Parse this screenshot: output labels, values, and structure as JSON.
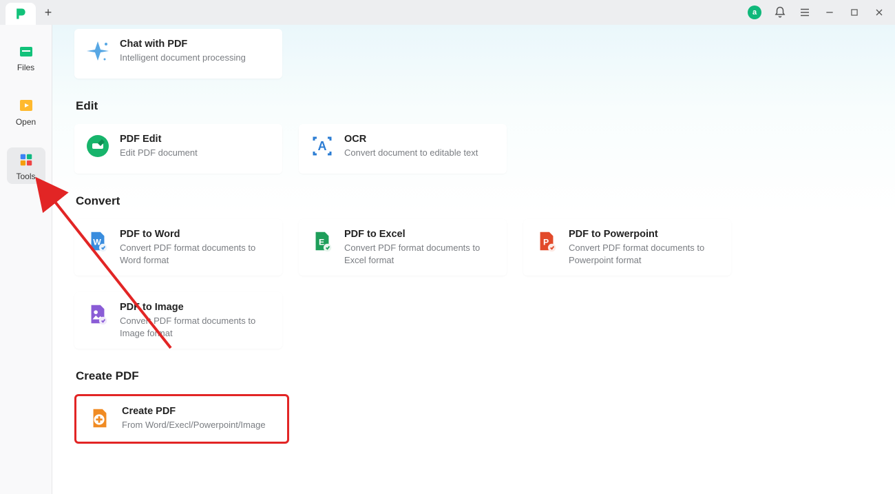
{
  "titlebar": {
    "user_letter": "a"
  },
  "sidebar": {
    "items": [
      {
        "label": "Files"
      },
      {
        "label": "Open"
      },
      {
        "label": "Tools"
      }
    ]
  },
  "sections": {
    "chat": {
      "card": {
        "title": "Chat with PDF",
        "desc": "Intelligent document processing"
      }
    },
    "edit": {
      "title": "Edit",
      "cards": [
        {
          "title": "PDF Edit",
          "desc": "Edit PDF document"
        },
        {
          "title": "OCR",
          "desc": "Convert document to editable text"
        }
      ]
    },
    "convert": {
      "title": "Convert",
      "cards": [
        {
          "title": "PDF to Word",
          "desc": "Convert PDF format documents to Word format"
        },
        {
          "title": "PDF to Excel",
          "desc": "Convert PDF format documents to Excel format"
        },
        {
          "title": "PDF to Powerpoint",
          "desc": "Convert PDF format documents to Powerpoint format"
        },
        {
          "title": "PDF to Image",
          "desc": "Convert PDF format documents to Image format"
        }
      ]
    },
    "create": {
      "title": "Create PDF",
      "card": {
        "title": "Create PDF",
        "desc": "From Word/Execl/Powerpoint/Image"
      }
    }
  }
}
